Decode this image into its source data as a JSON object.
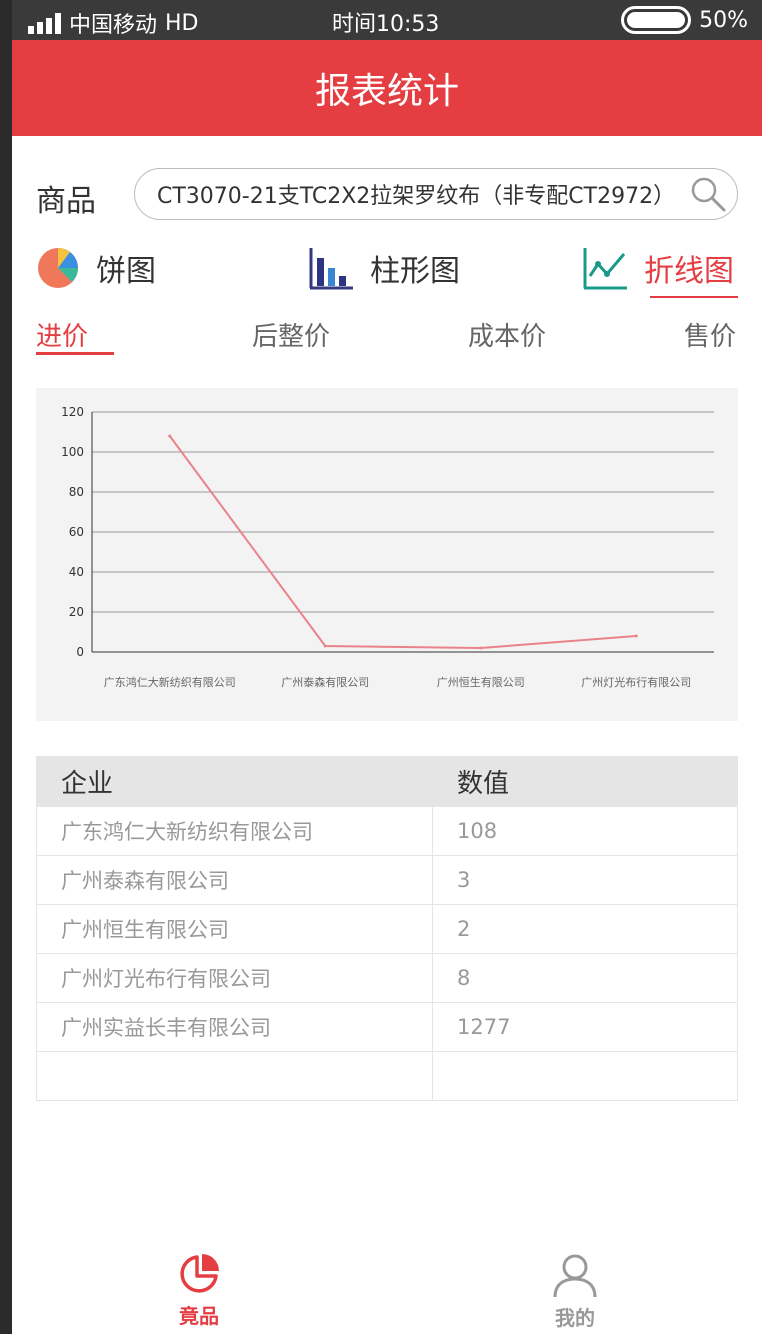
{
  "status_bar": {
    "carrier": "中国移动",
    "network": "HD",
    "time": "时间10:53",
    "battery": "50%"
  },
  "header": {
    "title": "报表统计"
  },
  "search": {
    "label": "商品",
    "value": "CT3070-21支TC2X2拉架罗纹布（非专配CT2972）"
  },
  "chart_types": [
    {
      "label": "饼图",
      "icon": "pie-chart-icon"
    },
    {
      "label": "柱形图",
      "icon": "bar-chart-icon"
    },
    {
      "label": "折线图",
      "icon": "line-chart-icon",
      "active": true
    }
  ],
  "price_tabs": [
    {
      "label": "进价",
      "active": true
    },
    {
      "label": "后整价"
    },
    {
      "label": "成本价"
    },
    {
      "label": "售价"
    }
  ],
  "colors": {
    "brand": "#e43e43",
    "tab_underline": "#e43c46",
    "line": "#e98389",
    "grid": "#999999",
    "axis_text": "#333333",
    "category_text": "#666666",
    "table_header_bg": "#e5e5e5",
    "search_border": "#bbbbbb"
  },
  "chart_data": {
    "type": "line",
    "categories": [
      "广东鸿仁大新纺织有限公司",
      "广州泰森有限公司",
      "广州恒生有限公司",
      "广州灯光布行有限公司"
    ],
    "values": [
      108,
      3,
      2,
      8
    ],
    "ylim": [
      0,
      120
    ],
    "yticks": [
      0,
      20,
      40,
      60,
      80,
      100,
      120
    ],
    "title": "",
    "xlabel": "",
    "ylabel": "",
    "grid": true
  },
  "table": {
    "headers": [
      "企业",
      "数值"
    ],
    "rows": [
      [
        "广东鸿仁大新纺织有限公司",
        "108"
      ],
      [
        "广州泰森有限公司",
        "3"
      ],
      [
        "广州恒生有限公司",
        "2"
      ],
      [
        "广州灯光布行有限公司",
        "8"
      ],
      [
        "广州实益长丰有限公司",
        "1277"
      ],
      [
        "",
        ""
      ]
    ]
  },
  "bottom_nav": [
    {
      "label": "竟品",
      "icon": "pie-chart-icon",
      "active": true
    },
    {
      "label": "我的",
      "icon": "user-icon"
    }
  ]
}
